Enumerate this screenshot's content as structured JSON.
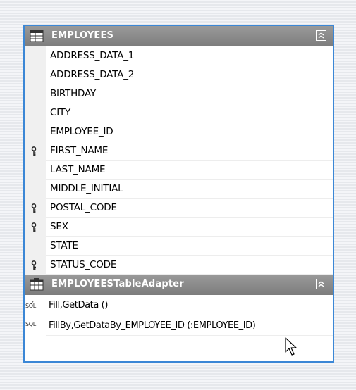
{
  "table": {
    "title": "EMPLOYEES",
    "columns": [
      {
        "name": "ADDRESS_DATA_1",
        "key": false
      },
      {
        "name": "ADDRESS_DATA_2",
        "key": false
      },
      {
        "name": "BIRTHDAY",
        "key": false
      },
      {
        "name": "CITY",
        "key": false
      },
      {
        "name": "EMPLOYEE_ID",
        "key": false
      },
      {
        "name": "FIRST_NAME",
        "key": true
      },
      {
        "name": "LAST_NAME",
        "key": false
      },
      {
        "name": "MIDDLE_INITIAL",
        "key": false
      },
      {
        "name": "POSTAL_CODE",
        "key": true
      },
      {
        "name": "SEX",
        "key": true
      },
      {
        "name": "STATE",
        "key": false
      },
      {
        "name": "STATUS_CODE",
        "key": true
      }
    ]
  },
  "adapter": {
    "title": "EMPLOYEESTableAdapter",
    "queries": [
      {
        "text": "Fill,GetData ()",
        "icon": "sql-check-icon"
      },
      {
        "text": "FillBy,GetDataBy_EMPLOYEE_ID (:EMPLOYEE_ID)",
        "icon": "sql-icon"
      }
    ]
  },
  "icons": {
    "table": "datatable-icon",
    "adapter": "tableadapter-icon",
    "key": "key-icon",
    "collapse": "collapse-chevron-icon",
    "cursor": "mouse-pointer-icon"
  },
  "colors": {
    "selection_border": "#3b87d6",
    "header": "#8c8c8c"
  }
}
